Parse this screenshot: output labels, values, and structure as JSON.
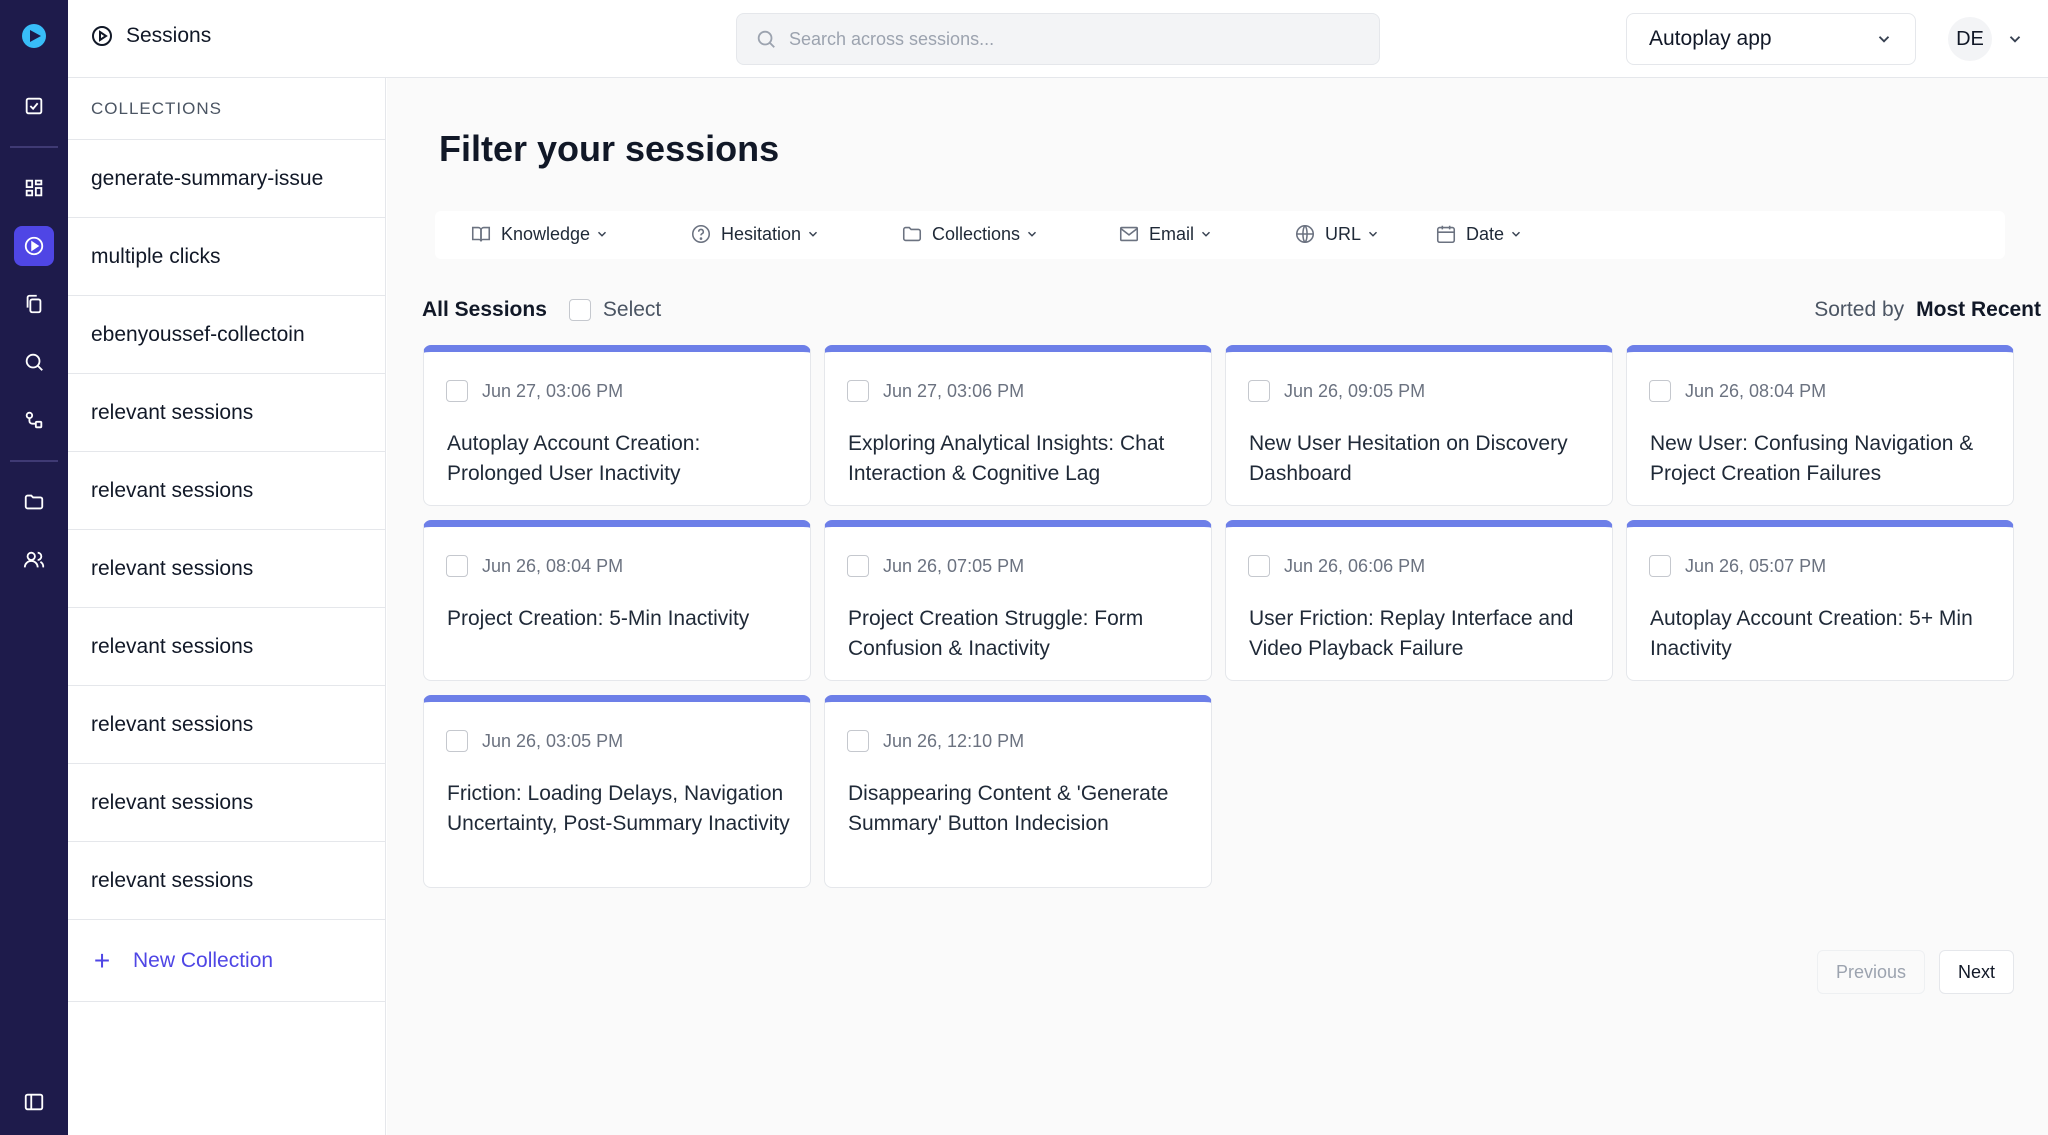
{
  "rail": {
    "icons": [
      "logo-icon",
      "checkbox-icon",
      "dashboard-icon",
      "play-icon",
      "copy-icon",
      "search-icon",
      "flow-icon",
      "folder-icon",
      "users-icon",
      "sidebar-toggle-icon"
    ],
    "accent": "#4f46e5",
    "background": "#1e1b4b"
  },
  "header": {
    "title": "Sessions",
    "search_placeholder": "Search across sessions...",
    "app_selector": "Autoplay app",
    "avatar_initials": "DE"
  },
  "collections": {
    "heading": "COLLECTIONS",
    "items": [
      "generate-summary-issue",
      "multiple clicks",
      "ebenyoussef-collectoin",
      "relevant sessions",
      "relevant sessions",
      "relevant sessions",
      "relevant sessions",
      "relevant sessions",
      "relevant sessions",
      "relevant sessions"
    ],
    "new_label": "New Collection"
  },
  "main": {
    "title": "Filter your sessions",
    "filters": [
      "Knowledge",
      "Hesitation",
      "Collections",
      "Email",
      "URL",
      "Date"
    ],
    "all_label": "All Sessions",
    "select_label": "Select",
    "sorted_by_label": "Sorted by",
    "sorted_by_value": "Most Recent",
    "sessions": [
      {
        "date": "Jun 27, 03:06 PM",
        "title": "Autoplay Account Creation: Prolonged User Inactivity"
      },
      {
        "date": "Jun 27, 03:06 PM",
        "title": "Exploring Analytical Insights: Chat Interaction & Cognitive Lag"
      },
      {
        "date": "Jun 26, 09:05 PM",
        "title": "New User Hesitation on Discovery Dashboard"
      },
      {
        "date": "Jun 26, 08:04 PM",
        "title": "New User: Confusing Navigation & Project Creation Failures"
      },
      {
        "date": "Jun 26, 08:04 PM",
        "title": "Project Creation: 5-Min Inactivity"
      },
      {
        "date": "Jun 26, 07:05 PM",
        "title": "Project Creation Struggle: Form Confusion & Inactivity"
      },
      {
        "date": "Jun 26, 06:06 PM",
        "title": "User Friction: Replay Interface and Video Playback Failure"
      },
      {
        "date": "Jun 26, 05:07 PM",
        "title": "Autoplay Account Creation: 5+ Min Inactivity"
      },
      {
        "date": "Jun 26, 03:05 PM",
        "title": "Friction: Loading Delays, Navigation Uncertainty, Post-Summary Inactivity"
      },
      {
        "date": "Jun 26, 12:10 PM",
        "title": "Disappearing Content & 'Generate Summary' Button Indecision"
      }
    ],
    "pager": {
      "previous": "Previous",
      "next": "Next"
    }
  }
}
